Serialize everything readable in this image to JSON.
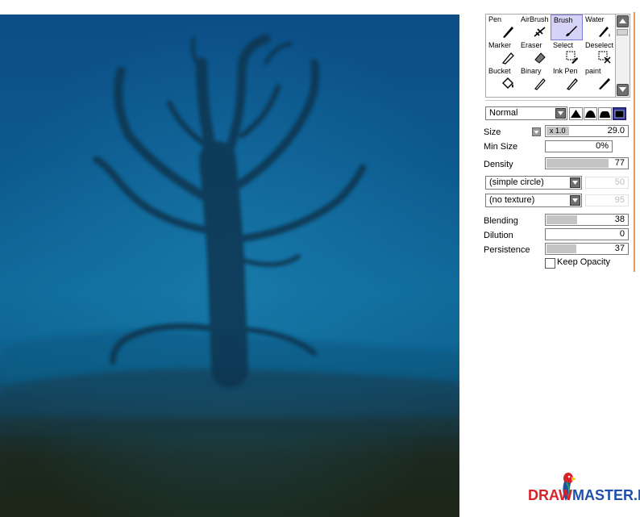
{
  "tools": {
    "items": [
      {
        "label": "Pen",
        "icon": "pen-icon",
        "active": false
      },
      {
        "label": "AirBrush",
        "icon": "airbrush-icon",
        "active": false
      },
      {
        "label": "Brush",
        "icon": "brush-icon",
        "active": true
      },
      {
        "label": "Water",
        "icon": "water-icon",
        "active": false
      },
      {
        "label": "Marker",
        "icon": "marker-icon",
        "active": false
      },
      {
        "label": "Eraser",
        "icon": "eraser-icon",
        "active": false
      },
      {
        "label": "Select",
        "icon": "select-icon",
        "active": false
      },
      {
        "label": "Deselect",
        "icon": "deselect-icon",
        "active": false
      },
      {
        "label": "Bucket",
        "icon": "bucket-icon",
        "active": false
      },
      {
        "label": "Binary",
        "icon": "binary-icon",
        "active": false
      },
      {
        "label": "Ink Pen",
        "icon": "ink-pen-icon",
        "active": false
      },
      {
        "label": "paint",
        "icon": "paint-icon",
        "active": false
      }
    ]
  },
  "brush": {
    "blend_mode": "Normal",
    "size_label": "Size",
    "size_multiplier": "x 1.0",
    "size_value": "29.0",
    "min_size_label": "Min Size",
    "min_size_value": "0%",
    "density_label": "Density",
    "density_value": "77",
    "density_level": 0.77,
    "shape_select": "(simple circle)",
    "shape_value": "50",
    "texture_select": "(no texture)",
    "texture_value": "95",
    "blending_label": "Blending",
    "blending_value": "38",
    "blending_level": 0.38,
    "dilution_label": "Dilution",
    "dilution_value": "0",
    "dilution_level": 0,
    "persistence_label": "Persistence",
    "persistence_value": "37",
    "persistence_level": 0.37,
    "keep_opacity_label": "Keep Opacity",
    "keep_opacity_checked": false
  },
  "watermark": {
    "text_red": "DRAW",
    "text_blue": "MASTER.RU"
  },
  "colors": {
    "active_tool_bg": "#d6d2f6",
    "active_shape": "#2f2d8f",
    "panel_accent": "#e39a5e",
    "logo_red": "#d8232a",
    "logo_blue": "#1f4fa8"
  }
}
